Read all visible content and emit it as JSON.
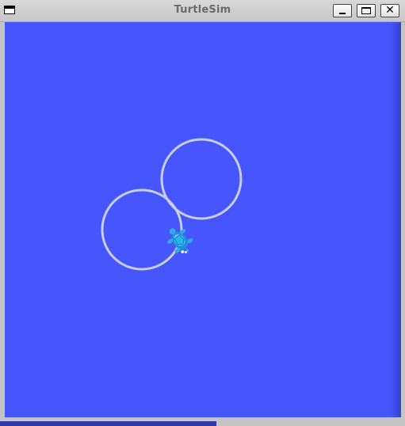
{
  "window": {
    "title": "TurtleSim",
    "close_glyph": "✕"
  },
  "icons": {
    "menu": "window-menu-icon",
    "minimize": "minimize-icon",
    "maximize": "maximize-icon",
    "close": "close-icon",
    "turtle": "turtle-icon"
  },
  "colors": {
    "background": "#4556ff",
    "pen": "#c8cdf0",
    "turtle": "#2fa9e8"
  },
  "status": {
    "progress": 0.535
  }
}
